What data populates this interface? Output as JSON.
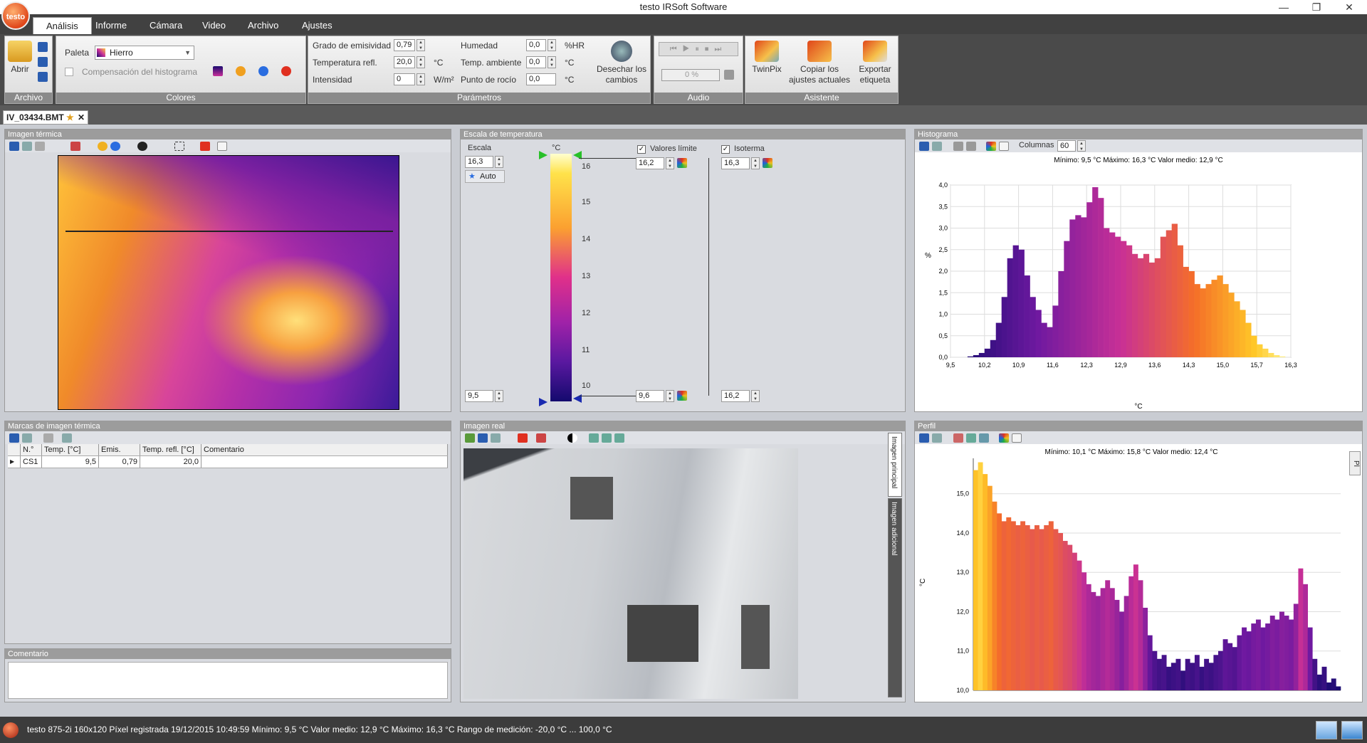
{
  "window": {
    "title": "testo IRSoft Software",
    "logo": "testo"
  },
  "tabs": [
    "Análisis",
    "Informe",
    "Cámara",
    "Video",
    "Archivo",
    "Ajustes"
  ],
  "ribbon": {
    "archivo": {
      "title": "Archivo",
      "open": "Abrir"
    },
    "colores": {
      "title": "Colores",
      "paleta_label": "Paleta",
      "paleta_value": "Hierro",
      "hist_comp": "Compensación del histograma"
    },
    "parametros": {
      "title": "Parámetros",
      "emis_label": "Grado de emisividad",
      "emis_value": "0,79",
      "tref_label": "Temperatura refl.",
      "tref_value": "20,0",
      "tref_unit": "°C",
      "int_label": "Intensidad",
      "int_value": "0",
      "int_unit": "W/m²",
      "hum_label": "Humedad",
      "hum_value": "0,0",
      "hum_unit": "%HR",
      "tamb_label": "Temp. ambiente",
      "tamb_value": "0,0",
      "tamb_unit": "°C",
      "dew_label": "Punto de rocío",
      "dew_value": "0,0",
      "dew_unit": "°C",
      "discard": "Desechar los cambios"
    },
    "audio": {
      "title": "Audio",
      "progress": "0 %"
    },
    "asistente": {
      "title": "Asistente",
      "twinpix": "TwinPix",
      "copy": "Copiar los ajustes actuales",
      "export": "Exportar etiqueta"
    }
  },
  "doc_tab": "IV_03434.BMT",
  "thermal": {
    "title": "Imagen térmica"
  },
  "scale": {
    "title": "Escala de temperatura",
    "escala_label": "Escala",
    "unit": "°C",
    "top_value": "16,3",
    "bottom_value": "9,5",
    "auto": "Auto",
    "limits_label": "Valores límite",
    "limit_top": "16,2",
    "limit_bottom": "9,6",
    "isotherm_label": "Isoterma",
    "iso_top": "16,3",
    "iso_bottom": "16,2",
    "ticks": [
      "16",
      "15",
      "14",
      "13",
      "12",
      "11",
      "10"
    ]
  },
  "histogram": {
    "title": "Histograma",
    "columns_label": "Columnas",
    "columns_value": "60",
    "stats": "Mínimo: 9,5 °C Máximo: 16,3 °C Valor medio: 12,9 °C",
    "ylabel": "%",
    "xlabel": "°C"
  },
  "profile": {
    "title": "Perfil",
    "stats": "Mínimo: 10,1 °C Máximo: 15,8 °C Valor medio: 12,4 °C",
    "ylabel": "°C",
    "side_tab": "Pl"
  },
  "marks": {
    "title": "Marcas de imagen térmica",
    "headers": [
      "N.°",
      "Temp. [°C]",
      "Emis.",
      "Temp. refl. [°C]",
      "Comentario"
    ],
    "rows": [
      [
        "CS1",
        "9,5",
        "0,79",
        "20,0",
        ""
      ]
    ]
  },
  "comment": {
    "title": "Comentario"
  },
  "real": {
    "title": "Imagen real",
    "tab_main": "Imagen principal",
    "tab_extra": "Imagen adicional"
  },
  "status": {
    "text": "testo 875-2i 160x120 Píxel registrada 19/12/2015 10:49:59 Mínimo: 9,5 °C Valor medio: 12,9 °C Máximo: 16,3 °C Rango de medición: -20,0 °C ... 100,0 °C"
  },
  "colors": {
    "iron_low": "#140a6e",
    "iron_mid": "#c8309a",
    "iron_high": "#ffee9a",
    "accent": "#e0461a"
  },
  "chart_data": [
    {
      "type": "bar",
      "title": "Mínimo: 9,5 °C Máximo: 16,3 °C Valor medio: 12,9 °C",
      "xlabel": "°C",
      "ylabel": "%",
      "xlim": [
        9.5,
        16.3
      ],
      "ylim": [
        0,
        4.0
      ],
      "xticks": [
        "9,5",
        "10,2",
        "10,9",
        "11,6",
        "12,3",
        "12,9",
        "13,6",
        "14,3",
        "15,0",
        "15,7",
        "16,3"
      ],
      "yticks": [
        "0,0",
        "0,5",
        "1,0",
        "1,5",
        "2,0",
        "2,5",
        "3,0",
        "3,5",
        "4,0"
      ],
      "values": [
        0.0,
        0.0,
        0.0,
        0.02,
        0.05,
        0.1,
        0.2,
        0.4,
        0.8,
        1.4,
        2.3,
        2.6,
        2.5,
        1.9,
        1.4,
        1.1,
        0.8,
        0.7,
        1.2,
        2.0,
        2.7,
        3.2,
        3.3,
        3.25,
        3.6,
        3.95,
        3.7,
        3.0,
        2.9,
        2.8,
        2.7,
        2.6,
        2.4,
        2.3,
        2.4,
        2.2,
        2.3,
        2.8,
        2.95,
        3.1,
        2.6,
        2.1,
        2.0,
        1.7,
        1.6,
        1.7,
        1.8,
        1.9,
        1.7,
        1.5,
        1.3,
        1.1,
        0.8,
        0.5,
        0.3,
        0.2,
        0.1,
        0.05,
        0.02,
        0.0
      ]
    },
    {
      "type": "bar",
      "title": "Mínimo: 10,1 °C Máximo: 15,8 °C Valor medio: 12,4 °C",
      "xlabel": "",
      "ylabel": "°C",
      "ylim": [
        10.0,
        15.9
      ],
      "yticks": [
        "10,0",
        "11,0",
        "12,0",
        "13,0",
        "14,0",
        "15,0"
      ],
      "values": [
        15.6,
        15.8,
        15.5,
        15.2,
        14.8,
        14.5,
        14.3,
        14.4,
        14.3,
        14.2,
        14.3,
        14.2,
        14.1,
        14.2,
        14.1,
        14.2,
        14.3,
        14.1,
        14.0,
        13.8,
        13.7,
        13.5,
        13.3,
        13.0,
        12.7,
        12.5,
        12.4,
        12.6,
        12.8,
        12.6,
        12.3,
        12.0,
        12.4,
        12.9,
        13.2,
        12.8,
        12.1,
        11.4,
        11.0,
        10.8,
        10.9,
        10.6,
        10.7,
        10.8,
        10.5,
        10.8,
        10.7,
        10.9,
        10.6,
        10.8,
        10.7,
        10.9,
        11.0,
        11.3,
        11.2,
        11.1,
        11.4,
        11.6,
        11.5,
        11.7,
        11.8,
        11.6,
        11.7,
        11.9,
        11.8,
        12.0,
        11.9,
        11.8,
        12.2,
        13.1,
        12.7,
        11.6,
        10.8,
        10.4,
        10.6,
        10.2,
        10.3,
        10.1
      ]
    }
  ]
}
